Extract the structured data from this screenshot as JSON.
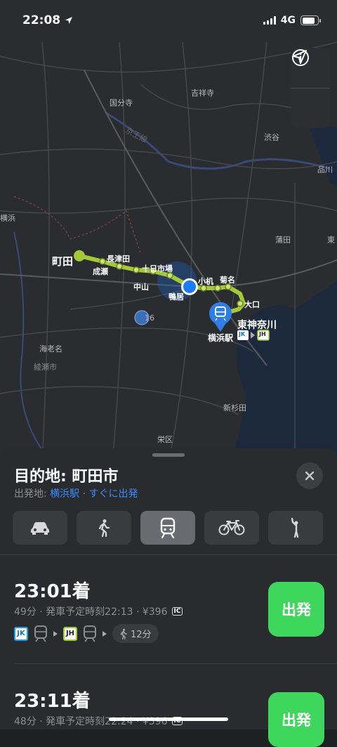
{
  "status_bar": {
    "time": "22:08",
    "network": "4G"
  },
  "map": {
    "labels": {
      "machida": "町田",
      "naruse": "成瀬",
      "nagatsuta": "長津田",
      "tokaichiba": "十日市場",
      "nakayama": "中山",
      "kamoi": "鴨居",
      "kozukue": "小机",
      "kikuna": "菊名",
      "oguchi": "大口",
      "higashikanagawa": "東神奈川",
      "yokohama_station": "横浜駅",
      "kokubunji": "国分寺",
      "kichijoji": "吉祥寺",
      "shibuya": "渋谷",
      "shinagawa": "品川",
      "kamata": "蒲田",
      "yokosuka": "横浜",
      "ebina": "海老名",
      "ayase": "綾瀬市",
      "shinsugita": "新杉田",
      "sakae": "栄区",
      "keio": "京王線",
      "route16": "16",
      "jk_badge": "JK",
      "jh_badge": "JH",
      "east_edge": "東"
    }
  },
  "controls": {
    "info": "info-icon",
    "locate": "location-arrow-icon"
  },
  "sheet": {
    "title": "目的地: 町田市",
    "from_prefix": "出発地: ",
    "from_place": "横浜駅",
    "separator": " · ",
    "departure": "すぐに出発",
    "modes": [
      "car",
      "walk",
      "transit",
      "bike",
      "ride"
    ]
  },
  "options": [
    {
      "arrival": "23:01着",
      "meta": "49分 · 発車予定時刻22:13 · ¥396",
      "ic": "IC",
      "line1": "JK",
      "line2": "JH",
      "walk": "12分",
      "go": "出発"
    },
    {
      "arrival": "23:11着",
      "meta": "48分 · 発車予定時刻22:24 · ¥396",
      "ic": "IC",
      "go": "出発"
    }
  ]
}
